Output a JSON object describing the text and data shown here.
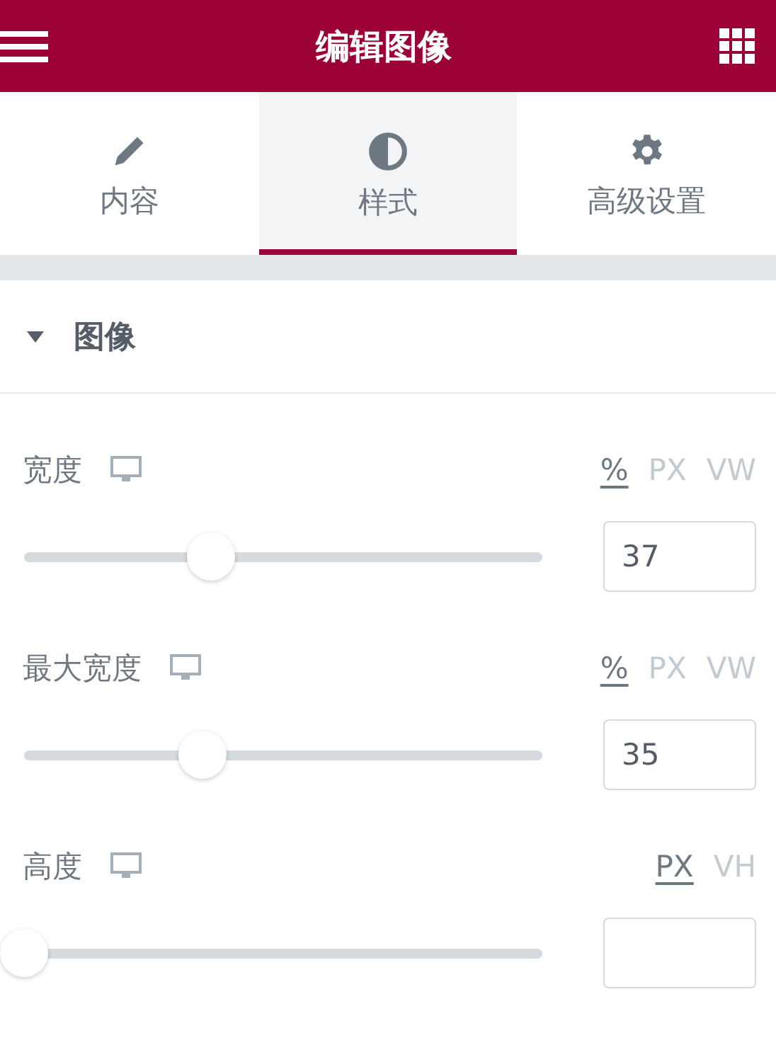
{
  "header": {
    "title": "编辑图像"
  },
  "tabs": [
    {
      "label": "内容",
      "kind": "pencil",
      "selected": false
    },
    {
      "label": "样式",
      "kind": "contrast",
      "selected": true
    },
    {
      "label": "高级设置",
      "kind": "gear",
      "selected": false
    }
  ],
  "section": {
    "title": "图像",
    "expanded": true
  },
  "controls": [
    {
      "label": "宽度",
      "units": [
        {
          "label": "%",
          "selected": true
        },
        {
          "label": "PX",
          "selected": false
        },
        {
          "label": "VW",
          "selected": false
        }
      ],
      "level": 0.36,
      "value": "37"
    },
    {
      "label": "最大宽度",
      "units": [
        {
          "label": "%",
          "selected": true
        },
        {
          "label": "PX",
          "selected": false
        },
        {
          "label": "VW",
          "selected": false
        }
      ],
      "level": 0.345,
      "value": "35"
    },
    {
      "label": "高度",
      "units": [
        {
          "label": "PX",
          "selected": true
        },
        {
          "label": "VH",
          "selected": false
        }
      ],
      "level": 0
    }
  ]
}
